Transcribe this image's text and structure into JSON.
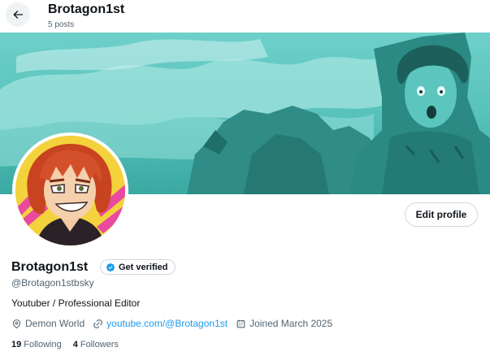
{
  "header": {
    "back_icon": "arrow-left-icon",
    "name": "Brotagon1st",
    "posts_count": "5 posts"
  },
  "banner": {
    "description_colors": {
      "tint": "#4fbfb8",
      "dark": "#1e6e69"
    }
  },
  "profile": {
    "display_name": "Brotagon1st",
    "verify_label": "Get verified",
    "verify_icon": "verified-badge-icon",
    "handle": "@Brotagon1stbsky",
    "bio": "Youtuber / Professional Editor",
    "edit_label": "Edit profile",
    "location_icon": "location-pin-icon",
    "location": "Demon World",
    "link_icon": "link-icon",
    "link": "youtube.com/@Brotagon1st",
    "calendar_icon": "calendar-icon",
    "joined": "Joined March 2025",
    "following_count": "19",
    "following_label": "Following",
    "followers_count": "4",
    "followers_label": "Followers"
  },
  "colors": {
    "accent": "#1d9bf0",
    "text_primary": "#0f1419",
    "text_secondary": "#536471",
    "border": "#cfd9de"
  }
}
